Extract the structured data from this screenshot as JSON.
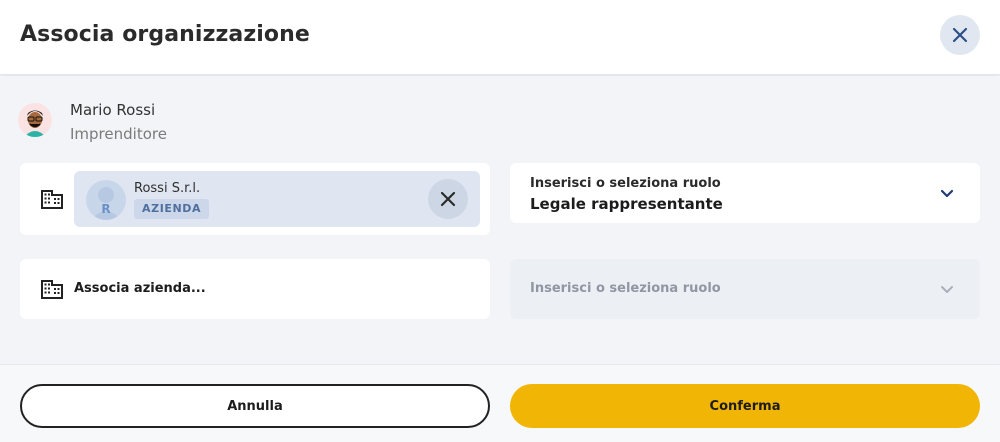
{
  "dialog": {
    "title": "Associa organizzazione"
  },
  "user": {
    "name": "Mario Rossi",
    "role": "Imprenditore",
    "avatar": "person-avatar-icon"
  },
  "organizations": [
    {
      "name": "Rossi S.r.l.",
      "initial": "R",
      "badge": "AZIENDA",
      "role_select": {
        "label": "Inserisci o seleziona ruolo",
        "value": "Legale rappresentante"
      }
    }
  ],
  "new_association": {
    "label": "Associa azienda...",
    "role_select": {
      "placeholder": "Inserisci o seleziona ruolo"
    }
  },
  "footer": {
    "cancel_label": "Annulla",
    "confirm_label": "Conferma"
  },
  "colors": {
    "accent": "#f0b505",
    "chip_bg": "#dfe6f1",
    "badge_text": "#4f6f9e",
    "page_bg": "#f2f4f8"
  },
  "icons": {
    "close": "close-icon",
    "building": "building-icon",
    "chevron": "chevron-down-icon",
    "remove": "remove-icon"
  }
}
